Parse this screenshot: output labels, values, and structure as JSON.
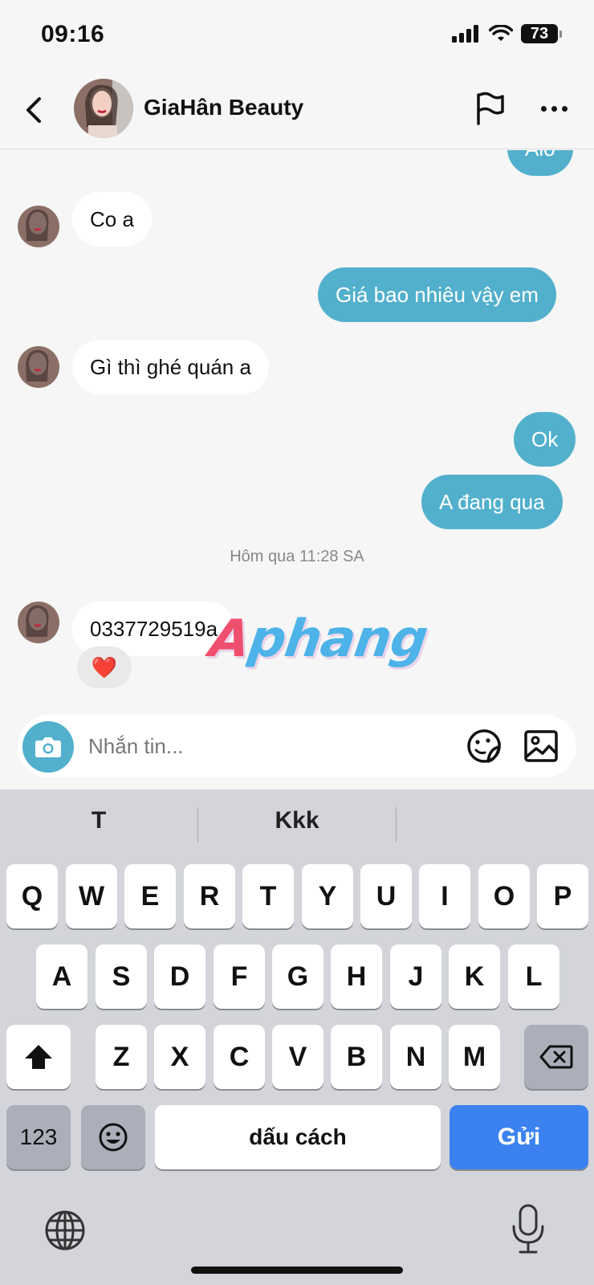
{
  "status_bar": {
    "time": "09:16",
    "battery": "73"
  },
  "header": {
    "contact_name": "GiaHân Beauty"
  },
  "messages": {
    "m0": "Alo",
    "m1": "Co a",
    "m2": "Giá bao nhiêu vậy em",
    "m3": "Gì thì ghé quán a",
    "m4": "Ok",
    "m5": "A đang qua",
    "timestamp": "Hôm qua 11:28 SA",
    "m6": "0337729519a",
    "m6_reaction": "❤️"
  },
  "watermark": {
    "first": "A",
    "rest": "phang"
  },
  "composer": {
    "placeholder": "Nhắn tin..."
  },
  "keyboard": {
    "suggestions": [
      "T",
      "Kkk",
      ""
    ],
    "row1": [
      "Q",
      "W",
      "E",
      "R",
      "T",
      "Y",
      "U",
      "I",
      "O",
      "P"
    ],
    "row2": [
      "A",
      "S",
      "D",
      "F",
      "G",
      "H",
      "J",
      "K",
      "L"
    ],
    "row3": [
      "Z",
      "X",
      "C",
      "V",
      "B",
      "N",
      "M"
    ],
    "numbers_key": "123",
    "space_key": "dấu cách",
    "send_key": "Gửi"
  },
  "colors": {
    "accent": "#52b0cc",
    "send": "#3b82f0",
    "background": "#f6f6f6"
  },
  "icons": [
    "back-icon",
    "flag-icon",
    "more-icon",
    "camera-icon",
    "sticker-icon",
    "image-icon",
    "shift-icon",
    "backspace-icon",
    "emoji-icon",
    "globe-icon",
    "mic-icon",
    "signal-icon",
    "wifi-icon"
  ]
}
